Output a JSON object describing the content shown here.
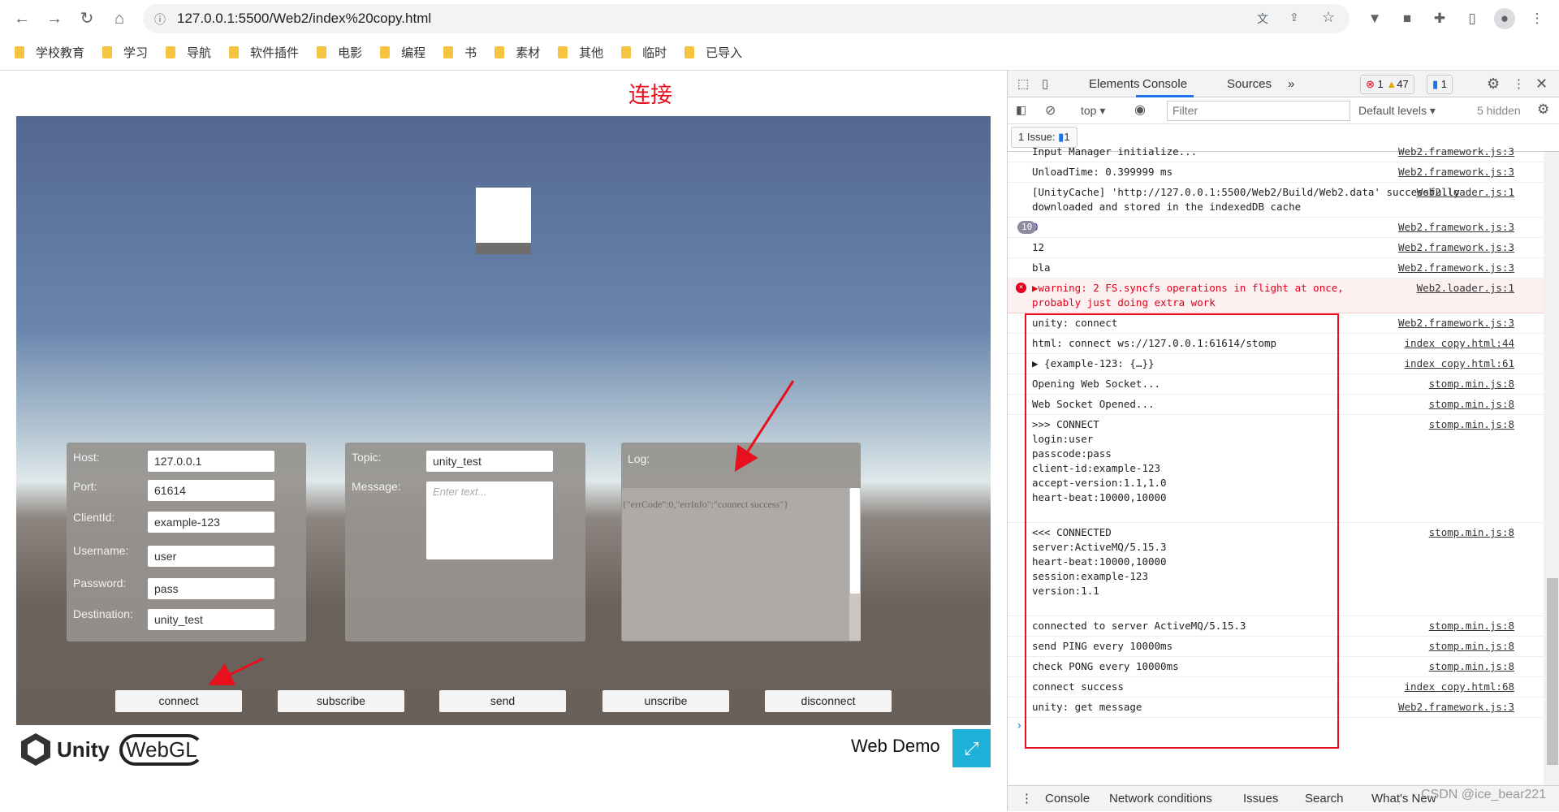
{
  "browser": {
    "url": "127.0.0.1:5500/Web2/index%20copy.html",
    "bookmarks": [
      "学校教育",
      "学习",
      "导航",
      "软件插件",
      "电影",
      "编程",
      "书",
      "素材",
      "其他",
      "临时",
      "已导入"
    ]
  },
  "page": {
    "title": "连接",
    "panel1": {
      "host_label": "Host:",
      "host": "127.0.0.1",
      "port_label": "Port:",
      "port": "61614",
      "clientid_label": "ClientId:",
      "clientid": "example-123",
      "username_label": "Username:",
      "username": "user",
      "password_label": "Password:",
      "password": "pass",
      "destination_label": "Destination:",
      "destination": "unity_test"
    },
    "panel2": {
      "topic_label": "Topic:",
      "topic": "unity_test",
      "message_label": "Message:",
      "message_placeholder": "Enter text..."
    },
    "panel3": {
      "log_label": "Log:",
      "log_text": "{\"errCode\":0,\"errInfo\":\"connect success\"}"
    },
    "buttons": [
      "connect",
      "subscribe",
      "send",
      "unscribe",
      "disconnect"
    ],
    "footer": {
      "unity": "Unity",
      "webgl": "WebGL",
      "web_demo": "Web Demo"
    },
    "accent": "#1fb0d8",
    "annotation_color": "#e8101c"
  },
  "devtools": {
    "tabs": [
      "Elements",
      "Console",
      "Sources",
      "»"
    ],
    "active_tab": "Console",
    "errors": "1",
    "warnings": "47",
    "messages": "1",
    "context": "top ▾",
    "filter_placeholder": "Filter",
    "levels": "Default levels ▾",
    "hidden": "5 hidden",
    "issues": "1 Issue:",
    "issues_count": "1",
    "rows": [
      {
        "text": "Input Manager initialize...",
        "src": "Web2.framework.js:3"
      },
      {
        "text": "UnloadTime: 0.399999 ms",
        "src": "Web2.framework.js:3"
      },
      {
        "text": "[UnityCache] 'http://127.0.0.1:5500/Web2/Build/Web2.data' successfully downloaded and stored in the indexedDB cache",
        "src": "Web2.loader.js:1"
      },
      {
        "text": "0",
        "src": "Web2.framework.js:3",
        "badge": "10"
      },
      {
        "text": "12",
        "src": "Web2.framework.js:3"
      },
      {
        "text": "bla",
        "src": "Web2.framework.js:3"
      },
      {
        "text": "▶warning: 2 FS.syncfs operations in flight at once,\nprobably just doing extra work",
        "src": "Web2.loader.js:1",
        "level": "error"
      },
      {
        "text": "unity: connect",
        "src": "Web2.framework.js:3"
      },
      {
        "text": "html: connect ws://127.0.0.1:61614/stomp",
        "src": "index copy.html:44"
      },
      {
        "text": "▶ {example-123: {…}}",
        "src": "index copy.html:61"
      },
      {
        "text": "Opening Web Socket...",
        "src": "stomp.min.js:8"
      },
      {
        "text": "Web Socket Opened...",
        "src": "stomp.min.js:8"
      },
      {
        "text": ">>> CONNECT\nlogin:user\npasscode:pass\nclient-id:example-123\naccept-version:1.1,1.0\nheart-beat:10000,10000\n\n",
        "src": "stomp.min.js:8"
      },
      {
        "text": "<<< CONNECTED\nserver:ActiveMQ/5.15.3\nheart-beat:10000,10000\nsession:example-123\nversion:1.1\n\n",
        "src": "stomp.min.js:8"
      },
      {
        "text": "connected to server ActiveMQ/5.15.3",
        "src": "stomp.min.js:8"
      },
      {
        "text": "send PING every 10000ms",
        "src": "stomp.min.js:8"
      },
      {
        "text": "check PONG every 10000ms",
        "src": "stomp.min.js:8"
      },
      {
        "text": "connect success",
        "src": "index copy.html:68"
      },
      {
        "text": "unity: get message",
        "src": "Web2.framework.js:3"
      }
    ],
    "drawer": [
      "Console",
      "Network conditions",
      "Issues",
      "Search",
      "What's New"
    ]
  },
  "watermark": "CSDN @ice_bear221"
}
